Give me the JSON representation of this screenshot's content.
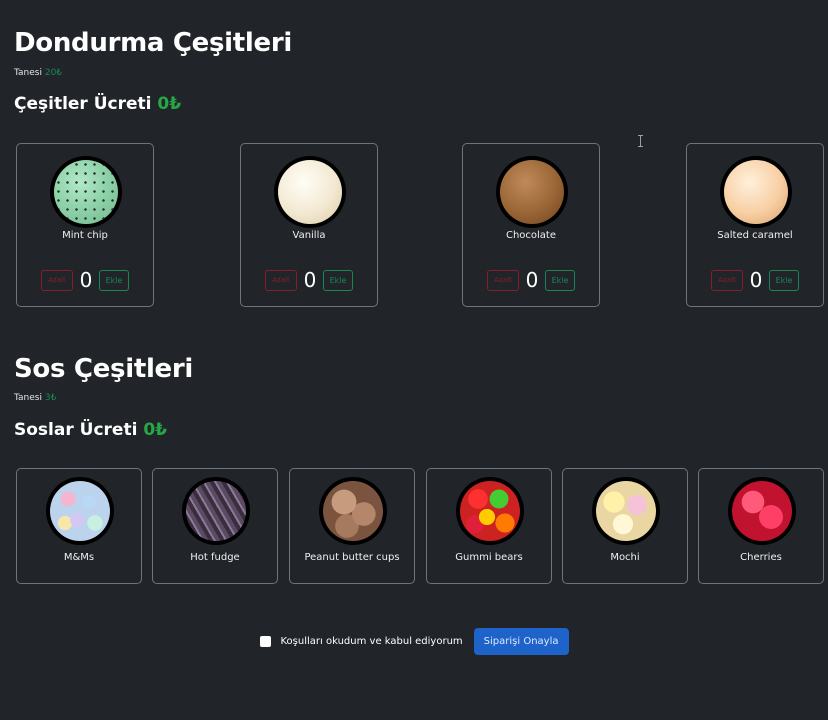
{
  "icecream_section": {
    "title": "Dondurma Çeşitleri",
    "unit_label": "Tanesi",
    "unit_price": "20₺",
    "subtotal_label": "Çeşitler Ücreti",
    "subtotal_amount": "0₺",
    "items": [
      {
        "name": "Mint chip",
        "count": "0",
        "remove_label": "Azalt",
        "add_label": "Ekle",
        "image": "mint-chip-scoop"
      },
      {
        "name": "Vanilla",
        "count": "0",
        "remove_label": "Azalt",
        "add_label": "Ekle",
        "image": "vanilla-scoop"
      },
      {
        "name": "Chocolate",
        "count": "0",
        "remove_label": "Azalt",
        "add_label": "Ekle",
        "image": "chocolate-scoop"
      },
      {
        "name": "Salted caramel",
        "count": "0",
        "remove_label": "Azalt",
        "add_label": "Ekle",
        "image": "salted-caramel-scoop"
      }
    ]
  },
  "topping_section": {
    "title": "Sos Çeşitleri",
    "unit_label": "Tanesi",
    "unit_price": "3₺",
    "subtotal_label": "Soslar Ücreti",
    "subtotal_amount": "0₺",
    "items": [
      {
        "name": "M&Ms",
        "image": "mms-topping"
      },
      {
        "name": "Hot fudge",
        "image": "hot-fudge-topping"
      },
      {
        "name": "Peanut butter cups",
        "image": "peanut-butter-cups-topping"
      },
      {
        "name": "Gummi bears",
        "image": "gummi-bears-topping"
      },
      {
        "name": "Mochi",
        "image": "mochi-topping"
      },
      {
        "name": "Cherries",
        "image": "cherries-topping"
      }
    ]
  },
  "footer": {
    "terms_label": "Koşulları okudum ve kabul ediyorum",
    "terms_checked": false,
    "confirm_label": "Siparişi Onayla"
  },
  "colors": {
    "background": "#212529",
    "success": "#198754",
    "danger": "#842029",
    "primary": "#1e63c9",
    "border": "#6c757d"
  }
}
